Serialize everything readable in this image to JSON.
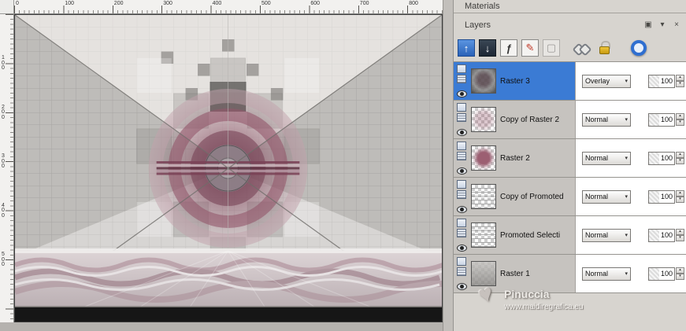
{
  "window": {
    "materials_title": "Materials",
    "layers_title": "Layers"
  },
  "header_icons": [
    {
      "name": "dock-panel-icon",
      "glyph": "▣"
    },
    {
      "name": "panel-menu-icon",
      "glyph": "▾"
    },
    {
      "name": "close-panel-icon",
      "glyph": "×"
    }
  ],
  "ruler": {
    "horizontal_labels": [
      "0",
      "100",
      "200",
      "300",
      "400",
      "500",
      "600",
      "700",
      "800"
    ],
    "vertical_labels": [
      "100",
      "200",
      "300",
      "400",
      "500"
    ]
  },
  "toolbar_icons": [
    {
      "name": "new-raster-layer-icon",
      "glyph": "↑"
    },
    {
      "name": "delete-layer-icon",
      "glyph": "↓"
    },
    {
      "name": "layer-styles-icon",
      "glyph": "ƒ"
    },
    {
      "name": "edit-layer-icon",
      "glyph": "✎"
    },
    {
      "name": "mask-layer-icon",
      "glyph": "▢"
    },
    {
      "name": "link-layers-icon",
      "glyph": ""
    },
    {
      "name": "lock-transparency-icon",
      "glyph": ""
    },
    {
      "name": "blend-mode-ring-icon",
      "glyph": ""
    }
  ],
  "controls": {
    "chevron": "▾",
    "spin_up": "▴",
    "spin_down": "▾"
  },
  "layers": [
    {
      "name": "Raster 3",
      "blend": "Overlay",
      "opacity": "100",
      "selected": true,
      "thumb": "art-dark"
    },
    {
      "name": "Copy of Raster 2",
      "blend": "Normal",
      "opacity": "100",
      "selected": false,
      "thumb": "checker-faint"
    },
    {
      "name": "Raster 2",
      "blend": "Normal",
      "opacity": "100",
      "selected": false,
      "thumb": "pink-circle"
    },
    {
      "name": "Copy of Promoted",
      "blend": "Normal",
      "opacity": "100",
      "selected": false,
      "thumb": "lines"
    },
    {
      "name": "Promoted Selecti",
      "blend": "Normal",
      "opacity": "100",
      "selected": false,
      "thumb": "lines"
    },
    {
      "name": "Raster 1",
      "blend": "Normal",
      "opacity": "100",
      "selected": false,
      "thumb": "gray-art"
    }
  ],
  "watermark": {
    "heart_glyph": "♥",
    "name": "Pinuccia",
    "url": "www.maidiregrafica.eu"
  }
}
